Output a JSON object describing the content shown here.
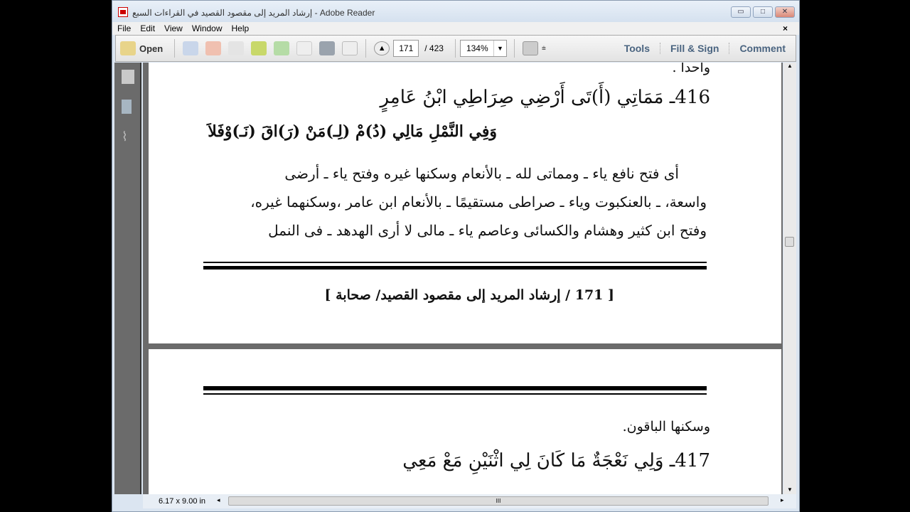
{
  "window": {
    "title": "إرشاد المريد إلى مقصود القصيد في القراءات السبع - Adobe Reader",
    "min": "▭",
    "max": "□",
    "close": "✕"
  },
  "menu": [
    "File",
    "Edit",
    "View",
    "Window",
    "Help"
  ],
  "menu_close": "×",
  "toolbar": {
    "open": "Open",
    "page_current": "171",
    "page_total": "/ 423",
    "zoom": "134%",
    "tools": "Tools",
    "fill_sign": "Fill & Sign",
    "comment": "Comment"
  },
  "page1": {
    "top_word": "واحداً .",
    "verse_line1": "416ـ مَمَاتِي (أَ)تَى أَرْضِي صِرَاطِي ابْنُ عَامِرٍ",
    "verse_line2": "وَفِي النَّمْلِ مَالِي (دُ)مْ (لِـ)مَنْ (رَ)اقَ (نَـ)وْفَلاَ",
    "commentary": [
      "أى فتح نافع ياء ـ ومماتى لله ـ بالأنعام وسكنها غيره وفتح ياء ـ أرضى",
      "واسعة، ـ بالعنكبوت وياء ـ صراطى مستقيمًا ـ بالأنعام ابن عامر ،وسكنهما غيره،",
      "وفتح ابن كثير وهشام والكسائى وعاصم ياء ـ مالى لا أرى الهدهد ـ فى النمل"
    ],
    "footer": "[ 171 / إرشاد المريد إلى مقصود القصيد/ صحابة ]"
  },
  "page2": {
    "line1": "وسكنها الباقون.",
    "verse": "417ـ وَلِي نَعْجَةٌ مَا كَانَ لِي اثْنَيْنِ مَعْ مَعِي"
  },
  "status": {
    "size": "6.17 x 9.00 in",
    "hscroll_grip": "III"
  }
}
